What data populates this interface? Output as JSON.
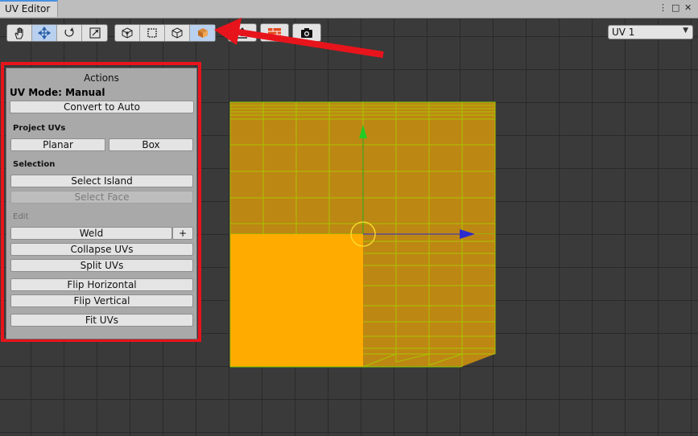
{
  "window": {
    "title": "UV Editor",
    "menu_glyph": "⋮",
    "maximize_glyph": "□",
    "close_glyph": "✕"
  },
  "toolbar": {
    "uv_channel": "UV 1"
  },
  "actions": {
    "title": "Actions",
    "uv_mode": "UV Mode: Manual",
    "convert_label": "Convert to Auto",
    "project_heading": "Project UVs",
    "planar_label": "Planar",
    "box_label": "Box",
    "selection_heading": "Selection",
    "select_island_label": "Select Island",
    "select_face_label": "Select Face",
    "edit_heading": "Edit",
    "weld_label": "Weld",
    "weld_plus_label": "+",
    "collapse_label": "Collapse UVs",
    "split_label": "Split UVs",
    "flip_h_label": "Flip Horizontal",
    "flip_v_label": "Flip Vertical",
    "fit_label": "Fit UVs"
  },
  "colors": {
    "accent": "#4a90e2",
    "highlight": "#e8141c",
    "uv_fill": "#f9a800",
    "uv_edge": "#c8ff00"
  },
  "icons": [
    "hand-icon",
    "move-icon",
    "rotate-icon",
    "scale-icon",
    "vertex-mode-icon",
    "edge-mode-icon",
    "face-mode-icon",
    "object-mode-icon",
    "upload-icon",
    "texture-grid-icon",
    "camera-icon",
    "chevron-down-icon"
  ]
}
